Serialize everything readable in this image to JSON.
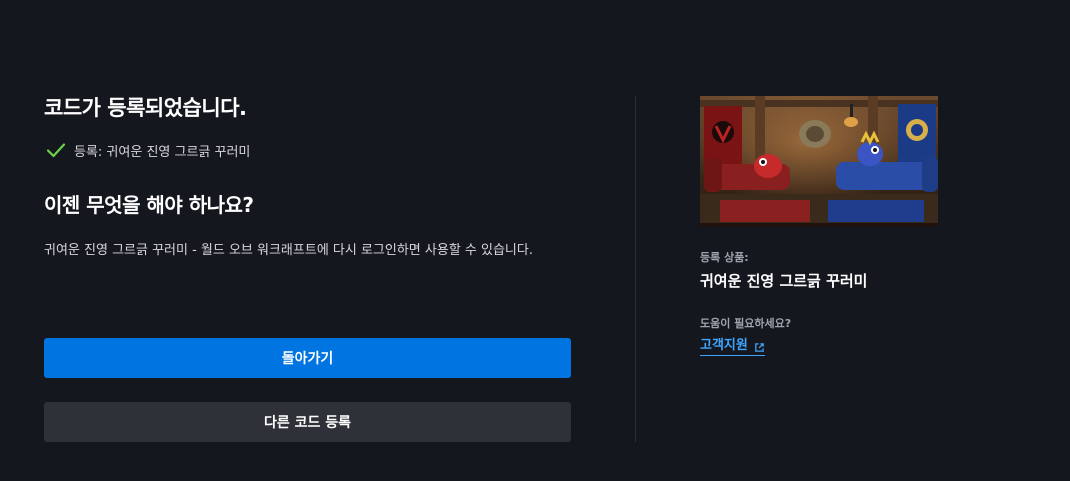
{
  "main": {
    "title": "코드가 등록되었습니다.",
    "registered_text": "등록: 귀여운 진영 그르긁 꾸러미",
    "subtitle": "이젠 무엇을 해야 하나요?",
    "description": "귀여운 진영 그르긁 꾸러미 - 월드 오브 워크래프트에 다시 로그인하면 사용할 수 있습니다.",
    "primary_button": "돌아가기",
    "secondary_button": "다른 코드 등록"
  },
  "sidebar": {
    "product_label": "등록 상품:",
    "product_name": "귀여운 진영 그르긁 꾸러미",
    "help_label": "도움이 필요하세요?",
    "support_link": "고객지원"
  },
  "icons": {
    "check": "check-icon",
    "external": "external-link-icon"
  },
  "colors": {
    "background": "#15171e",
    "primary": "#0074e0",
    "secondary": "#2f3138",
    "link": "#3ea6ff",
    "success": "#6fd14a"
  }
}
